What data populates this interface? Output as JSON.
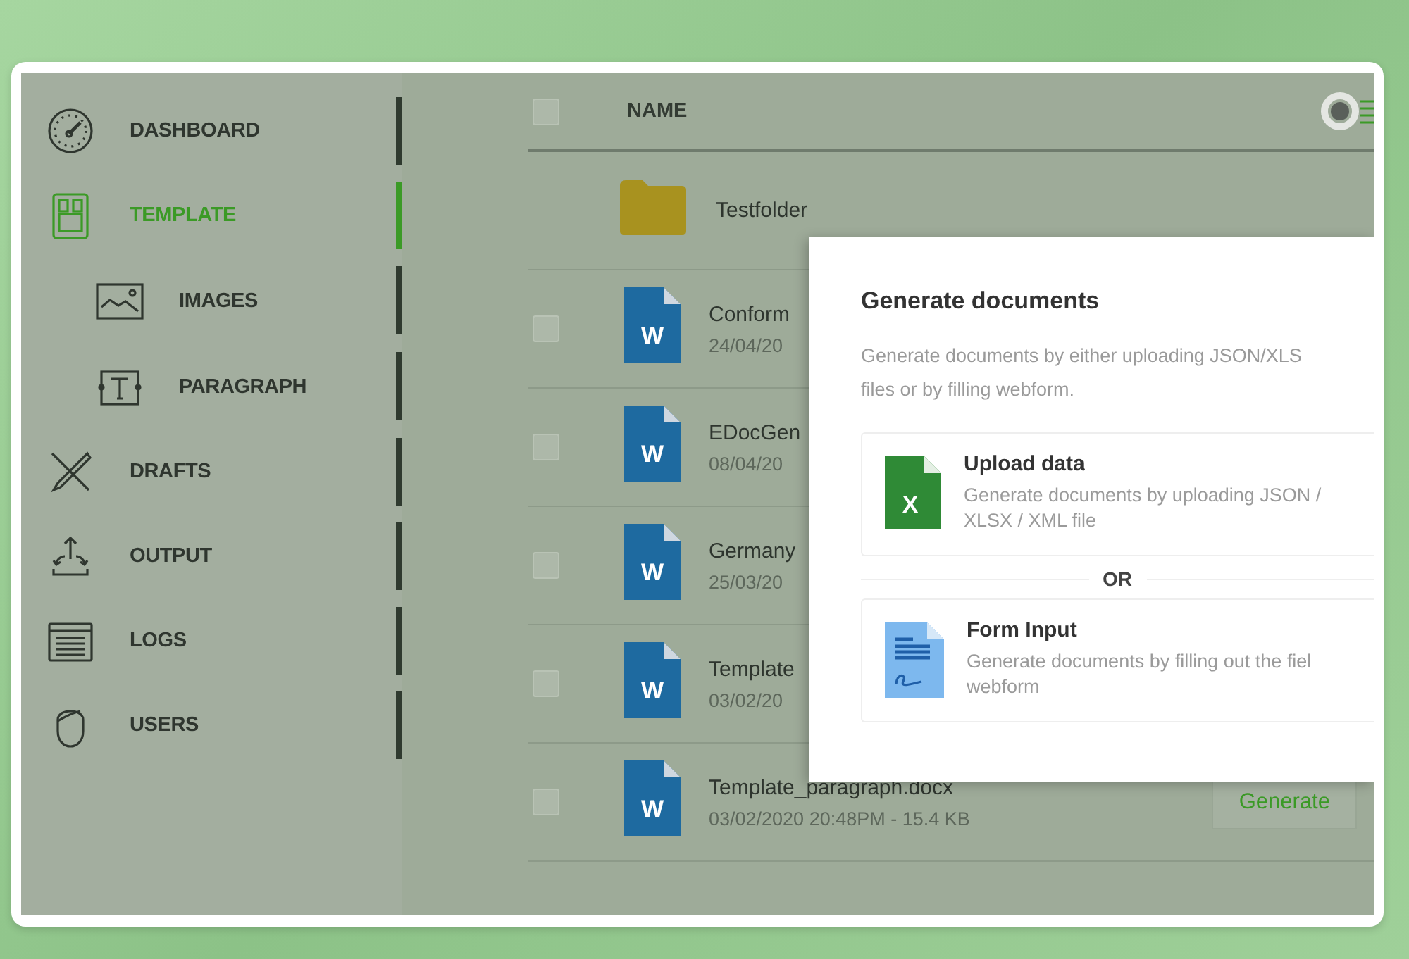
{
  "sidebar": {
    "items": [
      {
        "label": "DASHBOARD",
        "selected": false
      },
      {
        "label": "TEMPLATE",
        "selected": true,
        "children": [
          {
            "label": "IMAGES",
            "selected": false
          },
          {
            "label": "PARAGRAPH",
            "selected": false
          }
        ]
      },
      {
        "label": "DRAFTS",
        "selected": false
      },
      {
        "label": "OUTPUT",
        "selected": false
      },
      {
        "label": "LOGS",
        "selected": false
      },
      {
        "label": "USERS",
        "selected": false
      }
    ]
  },
  "table": {
    "header": {
      "checked": false,
      "columns": [
        {
          "label": "NAME"
        }
      ]
    },
    "rows": [
      {
        "kind": "folder",
        "name": "Testfolder"
      },
      {
        "kind": "document",
        "icon_letter": "W",
        "name": "Conform",
        "meta": "24/04/20",
        "checked": false
      },
      {
        "kind": "document",
        "icon_letter": "W",
        "name": "EDocGen",
        "meta": "08/04/20",
        "checked": false
      },
      {
        "kind": "document",
        "icon_letter": "W",
        "name": "Germany",
        "meta": "25/03/20",
        "checked": false
      },
      {
        "kind": "document",
        "icon_letter": "W",
        "name": "Template",
        "meta": "03/02/20",
        "checked": false
      },
      {
        "kind": "document",
        "icon_letter": "W",
        "name": "Template_paragraph.docx",
        "meta": "03/02/2020 20:48PM - 15.4 KB",
        "checked": false,
        "action": "Generate"
      }
    ]
  },
  "dialog": {
    "title": "Generate documents",
    "description": "Generate documents by either uploading JSON/XLS\nfiles or by filling webform.",
    "options": [
      {
        "kind": "spreadsheet",
        "icon_letter": "X",
        "title": "Upload data",
        "description": "Generate documents by uploading JSON /\nXLSX / XML file"
      },
      {
        "kind": "form",
        "title": "Form Input",
        "description": "Generate documents by filling out the fiel\nwebform"
      }
    ],
    "separator": "OR"
  }
}
